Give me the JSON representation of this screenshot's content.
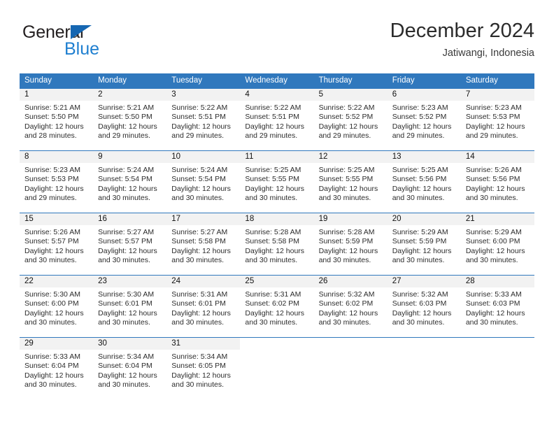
{
  "brand": {
    "word_one": "General",
    "word_two": "Blue",
    "triangle_color": "#1667b2",
    "blue_text_color": "#1f7fd0"
  },
  "header": {
    "title": "December 2024",
    "location": "Jatiwangi, Indonesia"
  },
  "theme": {
    "header_blue": "#3078bd",
    "date_band_gray": "#f2f2f2",
    "text_color": "#2c2c2c"
  },
  "weekday_headers": [
    "Sunday",
    "Monday",
    "Tuesday",
    "Wednesday",
    "Thursday",
    "Friday",
    "Saturday"
  ],
  "weeks": [
    [
      {
        "date": "1",
        "sunrise": "Sunrise: 5:21 AM",
        "sunset": "Sunset: 5:50 PM",
        "daylight_line1": "Daylight: 12 hours",
        "daylight_line2": "and 28 minutes."
      },
      {
        "date": "2",
        "sunrise": "Sunrise: 5:21 AM",
        "sunset": "Sunset: 5:50 PM",
        "daylight_line1": "Daylight: 12 hours",
        "daylight_line2": "and 29 minutes."
      },
      {
        "date": "3",
        "sunrise": "Sunrise: 5:22 AM",
        "sunset": "Sunset: 5:51 PM",
        "daylight_line1": "Daylight: 12 hours",
        "daylight_line2": "and 29 minutes."
      },
      {
        "date": "4",
        "sunrise": "Sunrise: 5:22 AM",
        "sunset": "Sunset: 5:51 PM",
        "daylight_line1": "Daylight: 12 hours",
        "daylight_line2": "and 29 minutes."
      },
      {
        "date": "5",
        "sunrise": "Sunrise: 5:22 AM",
        "sunset": "Sunset: 5:52 PM",
        "daylight_line1": "Daylight: 12 hours",
        "daylight_line2": "and 29 minutes."
      },
      {
        "date": "6",
        "sunrise": "Sunrise: 5:23 AM",
        "sunset": "Sunset: 5:52 PM",
        "daylight_line1": "Daylight: 12 hours",
        "daylight_line2": "and 29 minutes."
      },
      {
        "date": "7",
        "sunrise": "Sunrise: 5:23 AM",
        "sunset": "Sunset: 5:53 PM",
        "daylight_line1": "Daylight: 12 hours",
        "daylight_line2": "and 29 minutes."
      }
    ],
    [
      {
        "date": "8",
        "sunrise": "Sunrise: 5:23 AM",
        "sunset": "Sunset: 5:53 PM",
        "daylight_line1": "Daylight: 12 hours",
        "daylight_line2": "and 29 minutes."
      },
      {
        "date": "9",
        "sunrise": "Sunrise: 5:24 AM",
        "sunset": "Sunset: 5:54 PM",
        "daylight_line1": "Daylight: 12 hours",
        "daylight_line2": "and 30 minutes."
      },
      {
        "date": "10",
        "sunrise": "Sunrise: 5:24 AM",
        "sunset": "Sunset: 5:54 PM",
        "daylight_line1": "Daylight: 12 hours",
        "daylight_line2": "and 30 minutes."
      },
      {
        "date": "11",
        "sunrise": "Sunrise: 5:25 AM",
        "sunset": "Sunset: 5:55 PM",
        "daylight_line1": "Daylight: 12 hours",
        "daylight_line2": "and 30 minutes."
      },
      {
        "date": "12",
        "sunrise": "Sunrise: 5:25 AM",
        "sunset": "Sunset: 5:55 PM",
        "daylight_line1": "Daylight: 12 hours",
        "daylight_line2": "and 30 minutes."
      },
      {
        "date": "13",
        "sunrise": "Sunrise: 5:25 AM",
        "sunset": "Sunset: 5:56 PM",
        "daylight_line1": "Daylight: 12 hours",
        "daylight_line2": "and 30 minutes."
      },
      {
        "date": "14",
        "sunrise": "Sunrise: 5:26 AM",
        "sunset": "Sunset: 5:56 PM",
        "daylight_line1": "Daylight: 12 hours",
        "daylight_line2": "and 30 minutes."
      }
    ],
    [
      {
        "date": "15",
        "sunrise": "Sunrise: 5:26 AM",
        "sunset": "Sunset: 5:57 PM",
        "daylight_line1": "Daylight: 12 hours",
        "daylight_line2": "and 30 minutes."
      },
      {
        "date": "16",
        "sunrise": "Sunrise: 5:27 AM",
        "sunset": "Sunset: 5:57 PM",
        "daylight_line1": "Daylight: 12 hours",
        "daylight_line2": "and 30 minutes."
      },
      {
        "date": "17",
        "sunrise": "Sunrise: 5:27 AM",
        "sunset": "Sunset: 5:58 PM",
        "daylight_line1": "Daylight: 12 hours",
        "daylight_line2": "and 30 minutes."
      },
      {
        "date": "18",
        "sunrise": "Sunrise: 5:28 AM",
        "sunset": "Sunset: 5:58 PM",
        "daylight_line1": "Daylight: 12 hours",
        "daylight_line2": "and 30 minutes."
      },
      {
        "date": "19",
        "sunrise": "Sunrise: 5:28 AM",
        "sunset": "Sunset: 5:59 PM",
        "daylight_line1": "Daylight: 12 hours",
        "daylight_line2": "and 30 minutes."
      },
      {
        "date": "20",
        "sunrise": "Sunrise: 5:29 AM",
        "sunset": "Sunset: 5:59 PM",
        "daylight_line1": "Daylight: 12 hours",
        "daylight_line2": "and 30 minutes."
      },
      {
        "date": "21",
        "sunrise": "Sunrise: 5:29 AM",
        "sunset": "Sunset: 6:00 PM",
        "daylight_line1": "Daylight: 12 hours",
        "daylight_line2": "and 30 minutes."
      }
    ],
    [
      {
        "date": "22",
        "sunrise": "Sunrise: 5:30 AM",
        "sunset": "Sunset: 6:00 PM",
        "daylight_line1": "Daylight: 12 hours",
        "daylight_line2": "and 30 minutes."
      },
      {
        "date": "23",
        "sunrise": "Sunrise: 5:30 AM",
        "sunset": "Sunset: 6:01 PM",
        "daylight_line1": "Daylight: 12 hours",
        "daylight_line2": "and 30 minutes."
      },
      {
        "date": "24",
        "sunrise": "Sunrise: 5:31 AM",
        "sunset": "Sunset: 6:01 PM",
        "daylight_line1": "Daylight: 12 hours",
        "daylight_line2": "and 30 minutes."
      },
      {
        "date": "25",
        "sunrise": "Sunrise: 5:31 AM",
        "sunset": "Sunset: 6:02 PM",
        "daylight_line1": "Daylight: 12 hours",
        "daylight_line2": "and 30 minutes."
      },
      {
        "date": "26",
        "sunrise": "Sunrise: 5:32 AM",
        "sunset": "Sunset: 6:02 PM",
        "daylight_line1": "Daylight: 12 hours",
        "daylight_line2": "and 30 minutes."
      },
      {
        "date": "27",
        "sunrise": "Sunrise: 5:32 AM",
        "sunset": "Sunset: 6:03 PM",
        "daylight_line1": "Daylight: 12 hours",
        "daylight_line2": "and 30 minutes."
      },
      {
        "date": "28",
        "sunrise": "Sunrise: 5:33 AM",
        "sunset": "Sunset: 6:03 PM",
        "daylight_line1": "Daylight: 12 hours",
        "daylight_line2": "and 30 minutes."
      }
    ],
    [
      {
        "date": "29",
        "sunrise": "Sunrise: 5:33 AM",
        "sunset": "Sunset: 6:04 PM",
        "daylight_line1": "Daylight: 12 hours",
        "daylight_line2": "and 30 minutes."
      },
      {
        "date": "30",
        "sunrise": "Sunrise: 5:34 AM",
        "sunset": "Sunset: 6:04 PM",
        "daylight_line1": "Daylight: 12 hours",
        "daylight_line2": "and 30 minutes."
      },
      {
        "date": "31",
        "sunrise": "Sunrise: 5:34 AM",
        "sunset": "Sunset: 6:05 PM",
        "daylight_line1": "Daylight: 12 hours",
        "daylight_line2": "and 30 minutes."
      },
      {
        "date": "",
        "sunrise": "",
        "sunset": "",
        "daylight_line1": "",
        "daylight_line2": ""
      },
      {
        "date": "",
        "sunrise": "",
        "sunset": "",
        "daylight_line1": "",
        "daylight_line2": ""
      },
      {
        "date": "",
        "sunrise": "",
        "sunset": "",
        "daylight_line1": "",
        "daylight_line2": ""
      },
      {
        "date": "",
        "sunrise": "",
        "sunset": "",
        "daylight_line1": "",
        "daylight_line2": ""
      }
    ]
  ]
}
